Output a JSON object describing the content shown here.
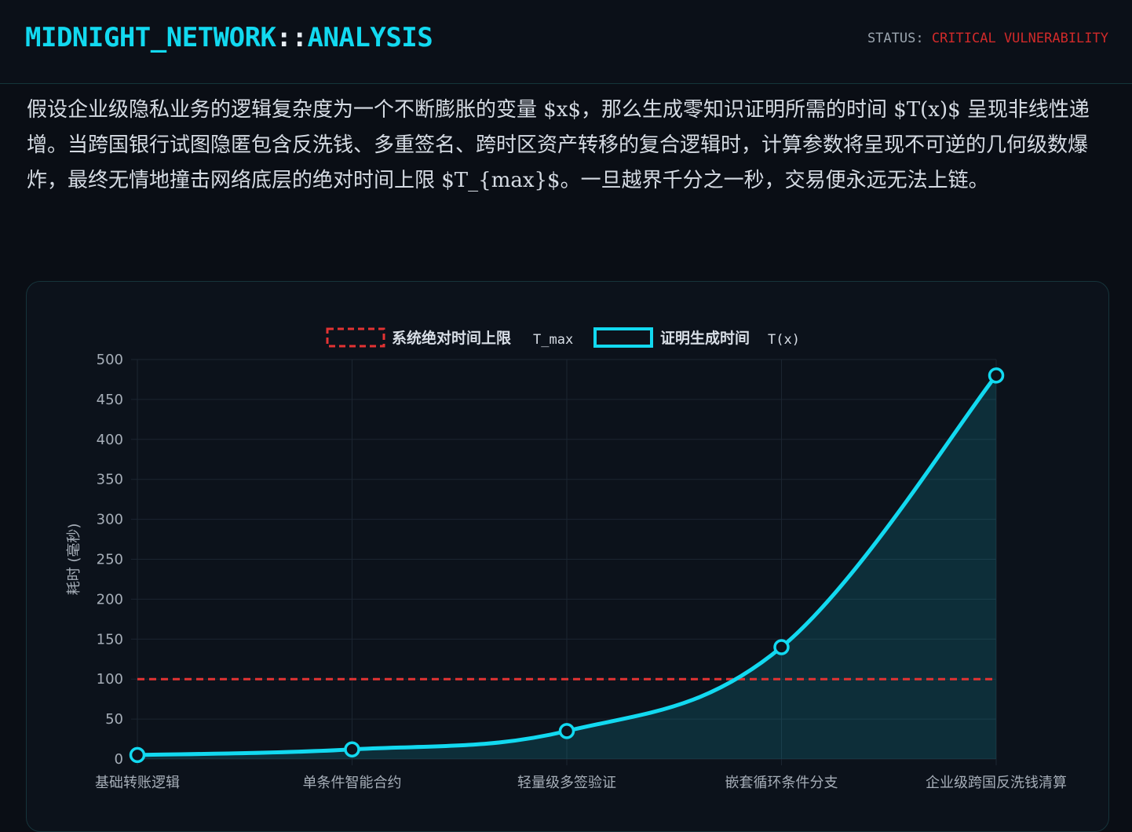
{
  "header": {
    "brand_main": "MIDNIGHT_NETWORK",
    "brand_sep": "::",
    "brand_sub": "ANALYSIS",
    "status_label": "STATUS: ",
    "status_value": "CRITICAL VULNERABILITY"
  },
  "description": "假设企业级隐私业务的逻辑复杂度为一个不断膨胀的变量 $x$，那么生成零知识证明所需的时间 $T(x)$ 呈现非线性递增。当跨国银行试图隐匿包含反洗钱、多重签名、跨时区资产转移的复合逻辑时，计算参数将呈现不可逆的几何级数爆炸，最终无情地撞击网络底层的绝对时间上限 $T_{max}$。一旦越界千分之一秒，交易便永远无法上链。",
  "colors": {
    "accent": "#12d9f0",
    "danger": "#e23333",
    "background": "#0a0e15",
    "panel": "#0c121b"
  },
  "chart_data": {
    "type": "line",
    "categories": [
      "基础转账逻辑",
      "单条件智能合约",
      "轻量级多签验证",
      "嵌套循环条件分支",
      "企业级跨国反洗钱清算"
    ],
    "series": [
      {
        "name": "证明生成时间",
        "name_code": "T(x)",
        "values": [
          5,
          12,
          35,
          140,
          480
        ],
        "color": "#12d9f0",
        "fill": true,
        "smooth": true
      },
      {
        "name": "系统绝对时间上限",
        "name_code": "T_max",
        "values": [
          100,
          100,
          100,
          100,
          100
        ],
        "color": "#e23333",
        "dashed": true
      }
    ],
    "legend_order": [
      1,
      0
    ],
    "ylabel": "耗时 (毫秒)",
    "xlabel": "",
    "ylim": [
      0,
      500
    ],
    "yticks": [
      0,
      50,
      100,
      150,
      200,
      250,
      300,
      350,
      400,
      450,
      500
    ],
    "grid": true,
    "legend_position": "top-center"
  }
}
